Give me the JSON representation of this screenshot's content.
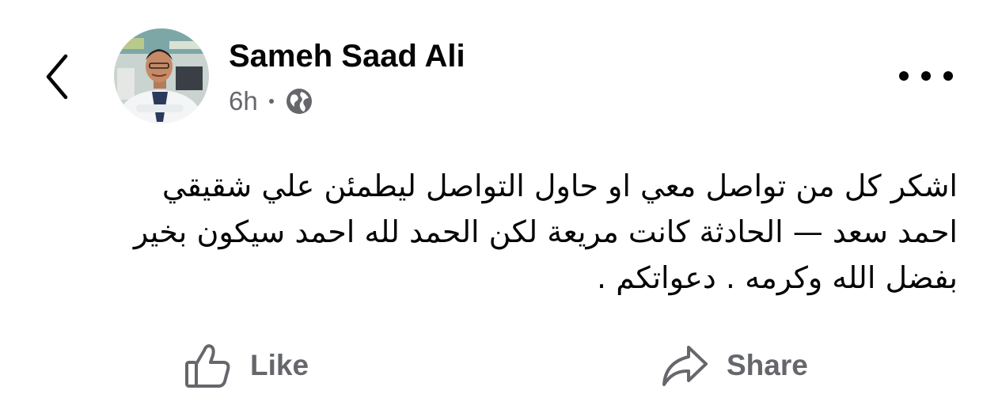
{
  "post": {
    "author": "Sameh Saad Ali",
    "time": "6h",
    "audience_icon": "globe-icon",
    "more_icon": "more-horizontal-icon",
    "back_icon": "chevron-left-icon",
    "text_lines": [
      "اشكر كل من تواصل معي او حاول التواصل ليطمئن علي شقيقي",
      "احمد سعد — الحادثة كانت مريعة لكن الحمد لله احمد سيكون بخير",
      "بفضل الله وكرمه . دعواتكم ."
    ]
  },
  "actions": {
    "like_label": "Like",
    "like_icon": "thumbs-up-icon",
    "share_label": "Share",
    "share_icon": "share-arrow-icon"
  },
  "colors": {
    "text": "#050505",
    "secondary_text": "#65676b",
    "background": "#ffffff"
  }
}
